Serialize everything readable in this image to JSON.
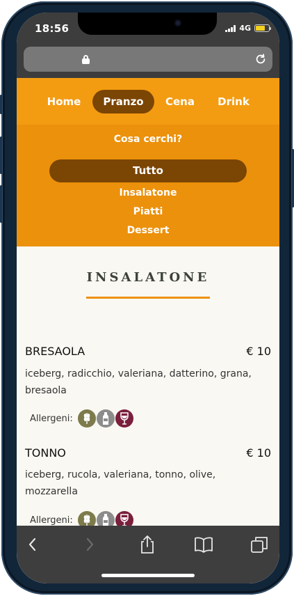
{
  "status": {
    "time": "18:56",
    "network": "4G"
  },
  "nav": {
    "items": [
      {
        "label": "Home"
      },
      {
        "label": "Pranzo"
      },
      {
        "label": "Cena"
      },
      {
        "label": "Drink"
      }
    ],
    "active_index": 1
  },
  "filter": {
    "question": "Cosa cerchi?",
    "options": [
      "Tutto",
      "Insalatone",
      "Piatti",
      "Dessert"
    ],
    "selected_index": 0
  },
  "section": {
    "title": "INSALATONE"
  },
  "dishes": [
    {
      "name": "BRESAOLA",
      "price": "€ 10",
      "desc_line1": "iceberg, radicchio, valeriana, datterino, grana,",
      "desc_line2": "bresaola",
      "allergens_label": "Allergeni:",
      "allergen_icons": [
        "gluten-icon",
        "lactose-icon",
        "sulphites-icon"
      ]
    },
    {
      "name": "TONNO",
      "price": "€ 10",
      "desc_line1": "iceberg, rucola, valeriana, tonno, olive,",
      "desc_line2": "mozzarella",
      "allergens_label": "Allergeni:",
      "allergen_icons": [
        "gluten-icon",
        "lactose-icon",
        "sulphites-icon"
      ]
    }
  ],
  "colors": {
    "brand_orange": "#f39c12",
    "filter_orange": "#ec910c",
    "active_brown": "#7b4504",
    "gluten": "#7d7a4c",
    "lactose": "#8c8c8c",
    "sulphites": "#7a1f3c"
  }
}
